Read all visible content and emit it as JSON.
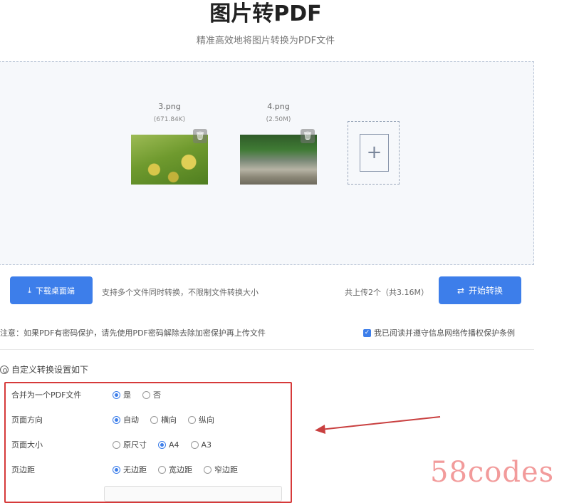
{
  "header": {
    "title": "图片转PDF",
    "subtitle": "精准高效地将图片转换为PDF文件"
  },
  "files": [
    {
      "name": "3.png",
      "size": "(671.84K)"
    },
    {
      "name": "4.png",
      "size": "(2.50M)"
    }
  ],
  "icons": {
    "delete": "trash-icon",
    "add": "plus-icon",
    "download": "download-icon",
    "convert": "swap-icon",
    "settings": "gear-icon"
  },
  "toolbar": {
    "download_label": "下载桌面端",
    "hint": "支持多个文件同时转换，不限制文件转换大小",
    "count": "共上传2个（共3.16M）",
    "convert_label": "开始转换"
  },
  "notice": "注意：如果PDF有密码保护，请先使用PDF密码解除去除加密保护再上传文件",
  "agreement": "我已阅读并遵守信息网络传播权保护条例",
  "settings": {
    "title": "自定义转换设置如下",
    "rows": [
      {
        "label": "合并为一个PDF文件",
        "options": [
          "是",
          "否"
        ],
        "selected": "是"
      },
      {
        "label": "页面方向",
        "options": [
          "自动",
          "横向",
          "纵向"
        ],
        "selected": "自动"
      },
      {
        "label": "页面大小",
        "options": [
          "原尺寸",
          "A4",
          "A3"
        ],
        "selected": "A4"
      },
      {
        "label": "页边距",
        "options": [
          "无边距",
          "宽边距",
          "窄边距"
        ],
        "selected": "无边距"
      }
    ]
  },
  "colors": {
    "accent": "#3d7eea",
    "highlight": "#d63a3a"
  },
  "watermark": "58codes"
}
